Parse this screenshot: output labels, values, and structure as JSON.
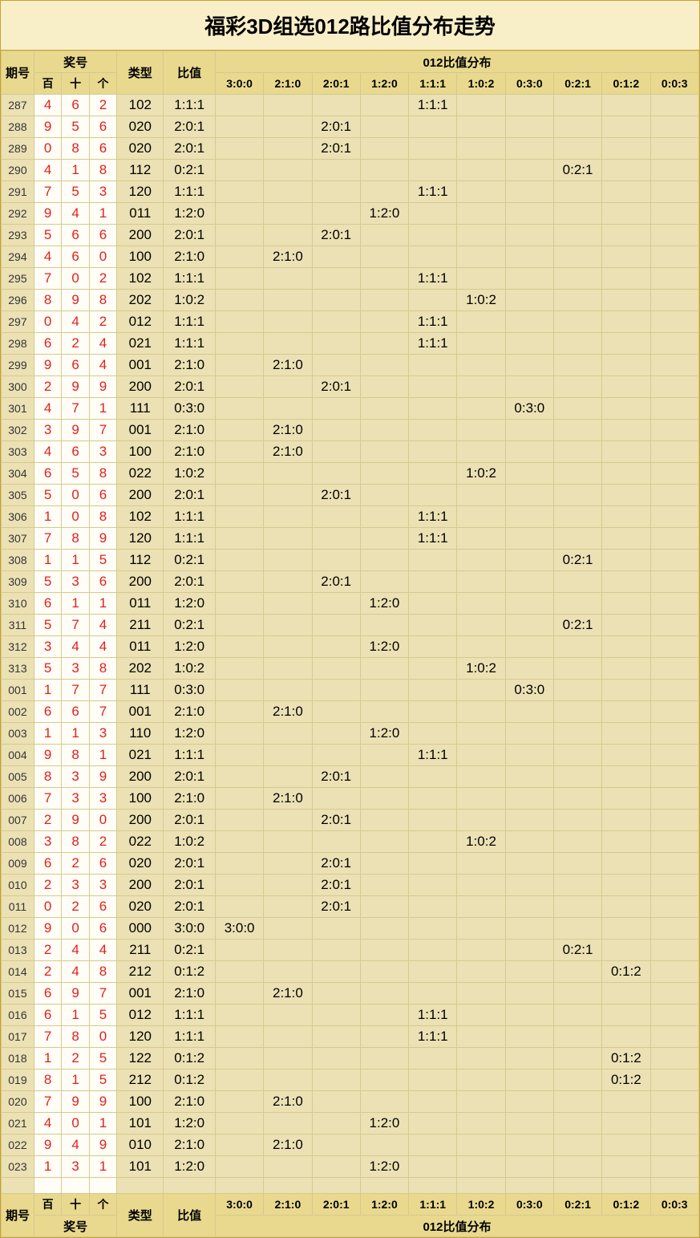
{
  "title": "福彩3D组选012路比值分布走势",
  "headers": {
    "issue": "期号",
    "numbers": "奖号",
    "bai": "百",
    "shi": "十",
    "ge": "个",
    "type": "类型",
    "ratio": "比值",
    "dist_group": "012比值分布"
  },
  "dist_cols": [
    "3:0:0",
    "2:1:0",
    "2:0:1",
    "1:2:0",
    "1:1:1",
    "1:0:2",
    "0:3:0",
    "0:2:1",
    "0:1:2",
    "0:0:3"
  ],
  "chart_data": {
    "type": "table",
    "title": "福彩3D组选012路比值分布走势",
    "columns": [
      "期号",
      "百",
      "十",
      "个",
      "类型",
      "比值"
    ],
    "ratio_categories": [
      "3:0:0",
      "2:1:0",
      "2:0:1",
      "1:2:0",
      "1:1:1",
      "1:0:2",
      "0:3:0",
      "0:2:1",
      "0:1:2",
      "0:0:3"
    ],
    "rows": [
      {
        "issue": "287",
        "d": [
          4,
          6,
          2
        ],
        "type": "102",
        "ratio": "1:1:1"
      },
      {
        "issue": "288",
        "d": [
          9,
          5,
          6
        ],
        "type": "020",
        "ratio": "2:0:1"
      },
      {
        "issue": "289",
        "d": [
          0,
          8,
          6
        ],
        "type": "020",
        "ratio": "2:0:1"
      },
      {
        "issue": "290",
        "d": [
          4,
          1,
          8
        ],
        "type": "112",
        "ratio": "0:2:1"
      },
      {
        "issue": "291",
        "d": [
          7,
          5,
          3
        ],
        "type": "120",
        "ratio": "1:1:1"
      },
      {
        "issue": "292",
        "d": [
          9,
          4,
          1
        ],
        "type": "011",
        "ratio": "1:2:0"
      },
      {
        "issue": "293",
        "d": [
          5,
          6,
          6
        ],
        "type": "200",
        "ratio": "2:0:1"
      },
      {
        "issue": "294",
        "d": [
          4,
          6,
          0
        ],
        "type": "100",
        "ratio": "2:1:0"
      },
      {
        "issue": "295",
        "d": [
          7,
          0,
          2
        ],
        "type": "102",
        "ratio": "1:1:1"
      },
      {
        "issue": "296",
        "d": [
          8,
          9,
          8
        ],
        "type": "202",
        "ratio": "1:0:2"
      },
      {
        "issue": "297",
        "d": [
          0,
          4,
          2
        ],
        "type": "012",
        "ratio": "1:1:1"
      },
      {
        "issue": "298",
        "d": [
          6,
          2,
          4
        ],
        "type": "021",
        "ratio": "1:1:1"
      },
      {
        "issue": "299",
        "d": [
          9,
          6,
          4
        ],
        "type": "001",
        "ratio": "2:1:0"
      },
      {
        "issue": "300",
        "d": [
          2,
          9,
          9
        ],
        "type": "200",
        "ratio": "2:0:1"
      },
      {
        "issue": "301",
        "d": [
          4,
          7,
          1
        ],
        "type": "111",
        "ratio": "0:3:0"
      },
      {
        "issue": "302",
        "d": [
          3,
          9,
          7
        ],
        "type": "001",
        "ratio": "2:1:0"
      },
      {
        "issue": "303",
        "d": [
          4,
          6,
          3
        ],
        "type": "100",
        "ratio": "2:1:0"
      },
      {
        "issue": "304",
        "d": [
          6,
          5,
          8
        ],
        "type": "022",
        "ratio": "1:0:2"
      },
      {
        "issue": "305",
        "d": [
          5,
          0,
          6
        ],
        "type": "200",
        "ratio": "2:0:1"
      },
      {
        "issue": "306",
        "d": [
          1,
          0,
          8
        ],
        "type": "102",
        "ratio": "1:1:1"
      },
      {
        "issue": "307",
        "d": [
          7,
          8,
          9
        ],
        "type": "120",
        "ratio": "1:1:1"
      },
      {
        "issue": "308",
        "d": [
          1,
          1,
          5
        ],
        "type": "112",
        "ratio": "0:2:1"
      },
      {
        "issue": "309",
        "d": [
          5,
          3,
          6
        ],
        "type": "200",
        "ratio": "2:0:1"
      },
      {
        "issue": "310",
        "d": [
          6,
          1,
          1
        ],
        "type": "011",
        "ratio": "1:2:0"
      },
      {
        "issue": "311",
        "d": [
          5,
          7,
          4
        ],
        "type": "211",
        "ratio": "0:2:1"
      },
      {
        "issue": "312",
        "d": [
          3,
          4,
          4
        ],
        "type": "011",
        "ratio": "1:2:0"
      },
      {
        "issue": "313",
        "d": [
          5,
          3,
          8
        ],
        "type": "202",
        "ratio": "1:0:2"
      },
      {
        "issue": "001",
        "d": [
          1,
          7,
          7
        ],
        "type": "111",
        "ratio": "0:3:0"
      },
      {
        "issue": "002",
        "d": [
          6,
          6,
          7
        ],
        "type": "001",
        "ratio": "2:1:0"
      },
      {
        "issue": "003",
        "d": [
          1,
          1,
          3
        ],
        "type": "110",
        "ratio": "1:2:0"
      },
      {
        "issue": "004",
        "d": [
          9,
          8,
          1
        ],
        "type": "021",
        "ratio": "1:1:1"
      },
      {
        "issue": "005",
        "d": [
          8,
          3,
          9
        ],
        "type": "200",
        "ratio": "2:0:1"
      },
      {
        "issue": "006",
        "d": [
          7,
          3,
          3
        ],
        "type": "100",
        "ratio": "2:1:0"
      },
      {
        "issue": "007",
        "d": [
          2,
          9,
          0
        ],
        "type": "200",
        "ratio": "2:0:1"
      },
      {
        "issue": "008",
        "d": [
          3,
          8,
          2
        ],
        "type": "022",
        "ratio": "1:0:2"
      },
      {
        "issue": "009",
        "d": [
          6,
          2,
          6
        ],
        "type": "020",
        "ratio": "2:0:1"
      },
      {
        "issue": "010",
        "d": [
          2,
          3,
          3
        ],
        "type": "200",
        "ratio": "2:0:1"
      },
      {
        "issue": "011",
        "d": [
          0,
          2,
          6
        ],
        "type": "020",
        "ratio": "2:0:1"
      },
      {
        "issue": "012",
        "d": [
          9,
          0,
          6
        ],
        "type": "000",
        "ratio": "3:0:0"
      },
      {
        "issue": "013",
        "d": [
          2,
          4,
          4
        ],
        "type": "211",
        "ratio": "0:2:1"
      },
      {
        "issue": "014",
        "d": [
          2,
          4,
          8
        ],
        "type": "212",
        "ratio": "0:1:2"
      },
      {
        "issue": "015",
        "d": [
          6,
          9,
          7
        ],
        "type": "001",
        "ratio": "2:1:0"
      },
      {
        "issue": "016",
        "d": [
          6,
          1,
          5
        ],
        "type": "012",
        "ratio": "1:1:1"
      },
      {
        "issue": "017",
        "d": [
          7,
          8,
          0
        ],
        "type": "120",
        "ratio": "1:1:1"
      },
      {
        "issue": "018",
        "d": [
          1,
          2,
          5
        ],
        "type": "122",
        "ratio": "0:1:2"
      },
      {
        "issue": "019",
        "d": [
          8,
          1,
          5
        ],
        "type": "212",
        "ratio": "0:1:2"
      },
      {
        "issue": "020",
        "d": [
          7,
          9,
          9
        ],
        "type": "100",
        "ratio": "2:1:0"
      },
      {
        "issue": "021",
        "d": [
          4,
          0,
          1
        ],
        "type": "101",
        "ratio": "1:2:0"
      },
      {
        "issue": "022",
        "d": [
          9,
          4,
          9
        ],
        "type": "010",
        "ratio": "2:1:0"
      },
      {
        "issue": "023",
        "d": [
          1,
          3,
          1
        ],
        "type": "101",
        "ratio": "1:2:0"
      }
    ]
  }
}
